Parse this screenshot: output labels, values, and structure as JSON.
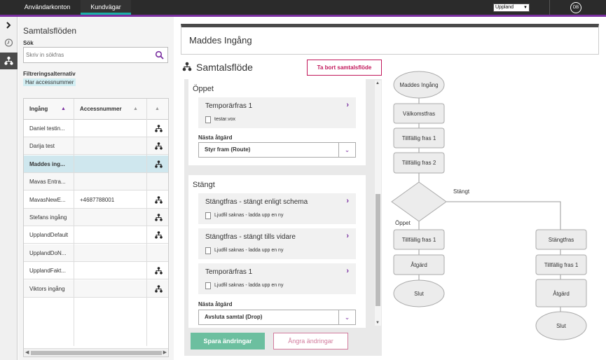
{
  "topnav": {
    "tabs": [
      {
        "label": "Användarkonton",
        "active": false
      },
      {
        "label": "Kundvägar",
        "active": true
      }
    ],
    "region": "Uppland",
    "user_initials": "DB"
  },
  "rail": {
    "items": [
      {
        "icon": "chevron-right-icon"
      },
      {
        "icon": "clock-icon"
      },
      {
        "icon": "flow-icon",
        "active": true
      }
    ]
  },
  "sidebar": {
    "title": "Samtalsflöden",
    "search_label": "Sök",
    "search_placeholder": "Skriv in sökfras",
    "filter_label": "Filtreringsalternativ",
    "filter_chip": "Har accessnummer",
    "table": {
      "headers": [
        "Ingång",
        "Accessnummer",
        ""
      ],
      "rows": [
        {
          "name": "Daniel testin...",
          "number": "",
          "flow": true
        },
        {
          "name": "Darija test",
          "number": "",
          "flow": true
        },
        {
          "name": "Maddes ing...",
          "number": "",
          "flow": true,
          "selected": true
        },
        {
          "name": "Mavas Entra...",
          "number": "",
          "flow": false
        },
        {
          "name": "MavasNewE...",
          "number": "+4687788001",
          "flow": true
        },
        {
          "name": "Stefans ingång",
          "number": "",
          "flow": true
        },
        {
          "name": "UpplandDefault",
          "number": "",
          "flow": true
        },
        {
          "name": "UpplandDoN...",
          "number": "",
          "flow": false
        },
        {
          "name": "UpplandFakt...",
          "number": "",
          "flow": true
        },
        {
          "name": "Viktors ingång",
          "number": "",
          "flow": true
        }
      ]
    }
  },
  "main": {
    "title": "Maddes Ingång",
    "flow_title": "Samtalsflöde",
    "delete_button": "Ta bort samtalsflöde",
    "sections": {
      "open": {
        "title": "Öppet",
        "items": [
          {
            "title": "Temporärfras 1",
            "file": "testar.vox"
          }
        ],
        "next_label": "Nästa åtgärd",
        "next_value": "Styr fram (Route)"
      },
      "closed": {
        "title": "Stängt",
        "items": [
          {
            "title": "Stängtfras - stängt enligt schema",
            "file": "Ljudfil saknas - ladda upp en ny"
          },
          {
            "title": "Stängtfras - stängt tills vidare",
            "file": "Ljudfil saknas - ladda upp en ny"
          },
          {
            "title": "Temporärfras 1",
            "file": "Ljudfil saknas - ladda upp en ny"
          }
        ],
        "next_label": "Nästa åtgärd",
        "next_value": "Avsluta samtal (Drop)"
      }
    },
    "save_button": "Spara ändringar",
    "undo_button": "Ångra ändringar"
  },
  "diagram": {
    "start": "Maddes Ingång",
    "welcome": "Välkomstfras",
    "temp1": "Tillfällig fras 1",
    "temp2": "Tillfällig fras 2",
    "branch_closed": "Stängt",
    "branch_open": "Öppet",
    "open_temp": "Tillfällig fras 1",
    "open_action": "Åtgärd",
    "open_end": "Slut",
    "closed_phrase": "Stängtfras",
    "closed_temp": "Tillfällig fras 1",
    "closed_action": "Åtgärd",
    "closed_end": "Slut"
  },
  "colors": {
    "accent": "#7a2fa0",
    "active_tab_underline": "#19b0a6",
    "danger": "#c2185b",
    "save": "#6cbf9f"
  }
}
